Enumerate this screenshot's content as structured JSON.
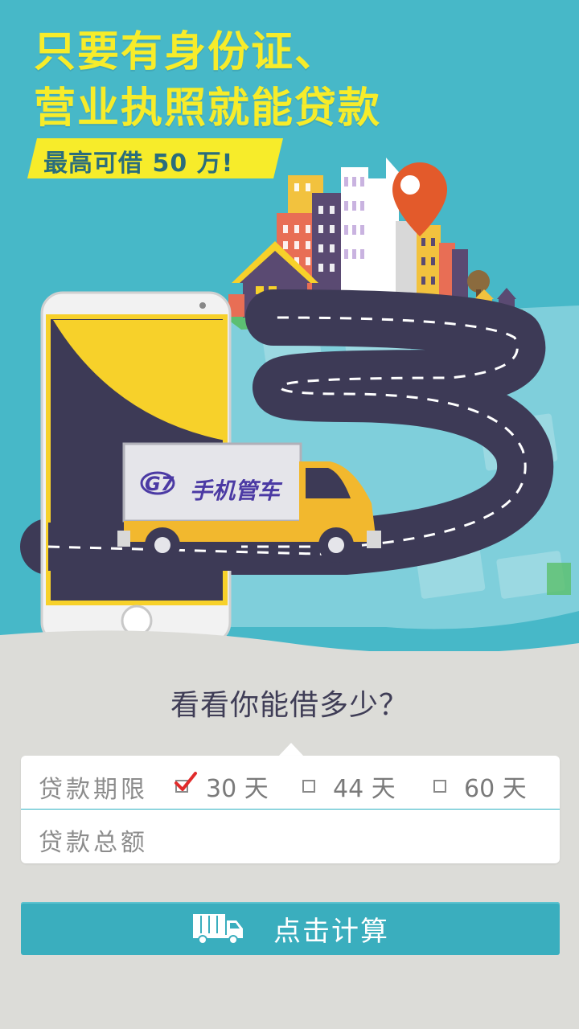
{
  "hero": {
    "headline_line1": "只要有身份证、",
    "headline_line2": "营业执照就能贷款",
    "subbadge": "最高可借 50 万!",
    "truck_logo": "G7",
    "truck_brand": "手机管车"
  },
  "question": "看看你能借多少？",
  "form": {
    "term_label": "贷款期限",
    "amount_label": "贷款总额",
    "options": [
      {
        "label": "30 天",
        "checked": true
      },
      {
        "label": "44 天",
        "checked": false
      },
      {
        "label": "60 天",
        "checked": false
      }
    ]
  },
  "calc_button": {
    "label": "点击计算",
    "icon": "truck-icon"
  },
  "colors": {
    "sky": "#47b8c8",
    "headline": "#f7ec2a",
    "road": "#3d3a56",
    "button": "#3aaebe",
    "check": "#e12b2b"
  }
}
